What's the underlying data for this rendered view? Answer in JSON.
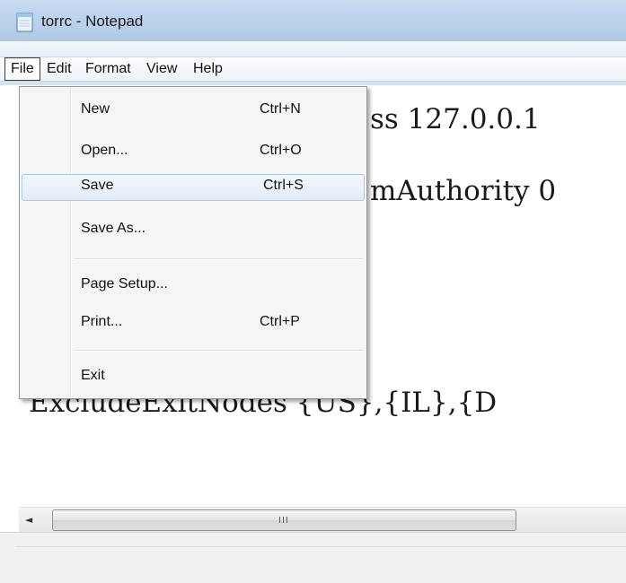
{
  "window": {
    "title": "torrc - Notepad"
  },
  "menubar": {
    "items": [
      "File",
      "Edit",
      "Format",
      "View",
      "Help"
    ]
  },
  "editor": {
    "lines": [
      "ss 127.0.0.1",
      "mAuthority 0",
      "ExcludeExitNodes {US},{IL},{D"
    ]
  },
  "file_menu": {
    "items": [
      {
        "label": "New",
        "shortcut": "Ctrl+N"
      },
      {
        "label": "Open...",
        "shortcut": "Ctrl+O"
      },
      {
        "label": "Save",
        "shortcut": "Ctrl+S"
      },
      {
        "label": "Save As...",
        "shortcut": ""
      },
      {
        "label": "Page Setup...",
        "shortcut": ""
      },
      {
        "label": "Print...",
        "shortcut": "Ctrl+P"
      },
      {
        "label": "Exit",
        "shortcut": ""
      }
    ],
    "highlighted": "Save"
  },
  "scrollbar": {
    "left_arrow": "◄",
    "grip": "III"
  },
  "colors": {
    "titlebar": "#bcd3ec",
    "menu_hover_border": "#a8c8ec"
  }
}
